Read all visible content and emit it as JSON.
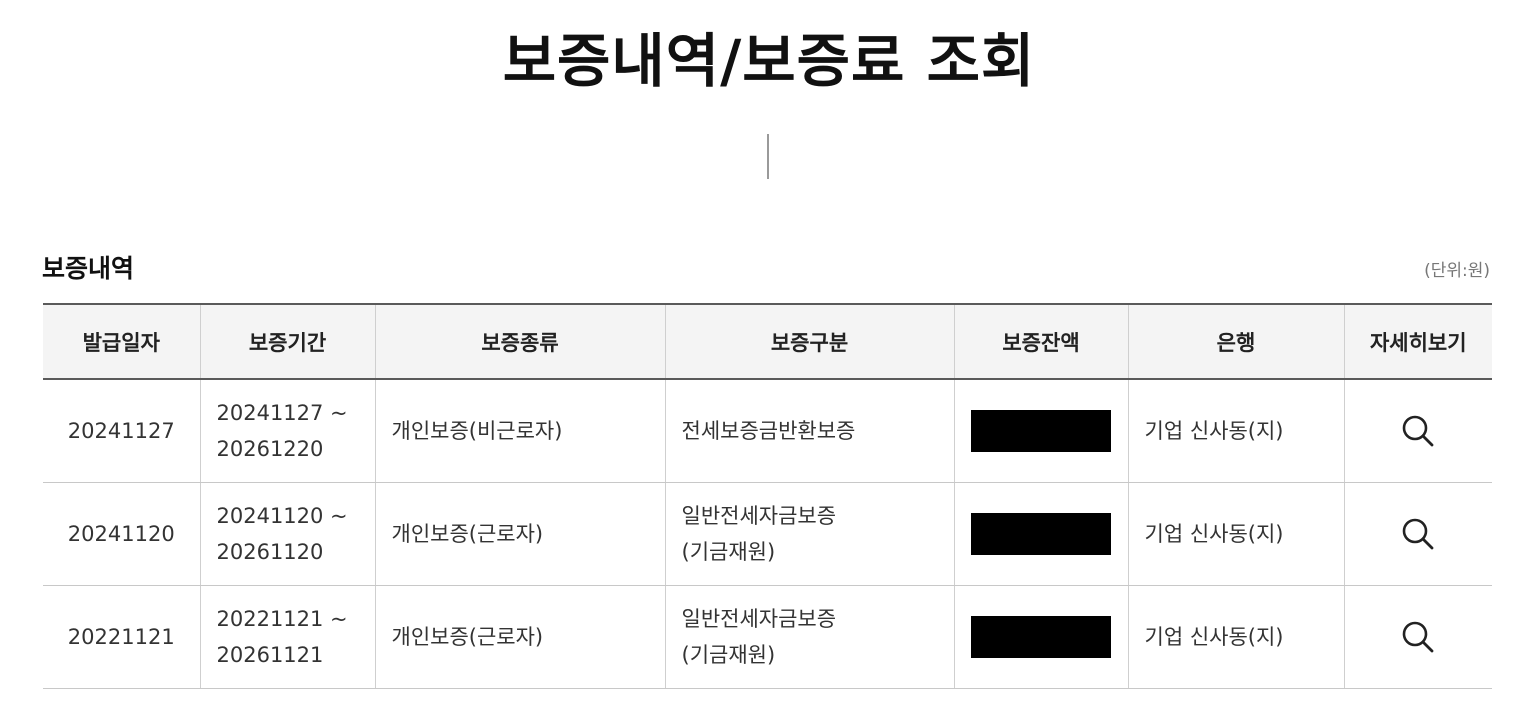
{
  "page": {
    "title": "보증내역/보증료 조회"
  },
  "section": {
    "title": "보증내역",
    "unit": "(단위:원)"
  },
  "table": {
    "headers": [
      "발급일자",
      "보증기간",
      "보증종류",
      "보증구분",
      "보증잔액",
      "은행",
      "자세히보기"
    ],
    "rows": [
      {
        "issue_date": "20241127",
        "period_start": "20241127 ~",
        "period_end": "20261220",
        "type": "개인보증(비근로자)",
        "category_line1": "전세보증금반환보증",
        "category_line2": "",
        "balance_redacted": true,
        "bank": "기업 신사동(지)",
        "detail_icon": "search-icon"
      },
      {
        "issue_date": "20241120",
        "period_start": "20241120 ~",
        "period_end": "20261120",
        "type": "개인보증(근로자)",
        "category_line1": "일반전세자금보증",
        "category_line2": "(기금재원)",
        "balance_redacted": true,
        "bank": "기업 신사동(지)",
        "detail_icon": "search-icon"
      },
      {
        "issue_date": "20221121",
        "period_start": "20221121 ~",
        "period_end": "20261121",
        "type": "개인보증(근로자)",
        "category_line1": "일반전세자금보증",
        "category_line2": "(기금재원)",
        "balance_redacted": true,
        "bank": "기업 신사동(지)",
        "detail_icon": "search-icon"
      }
    ]
  }
}
